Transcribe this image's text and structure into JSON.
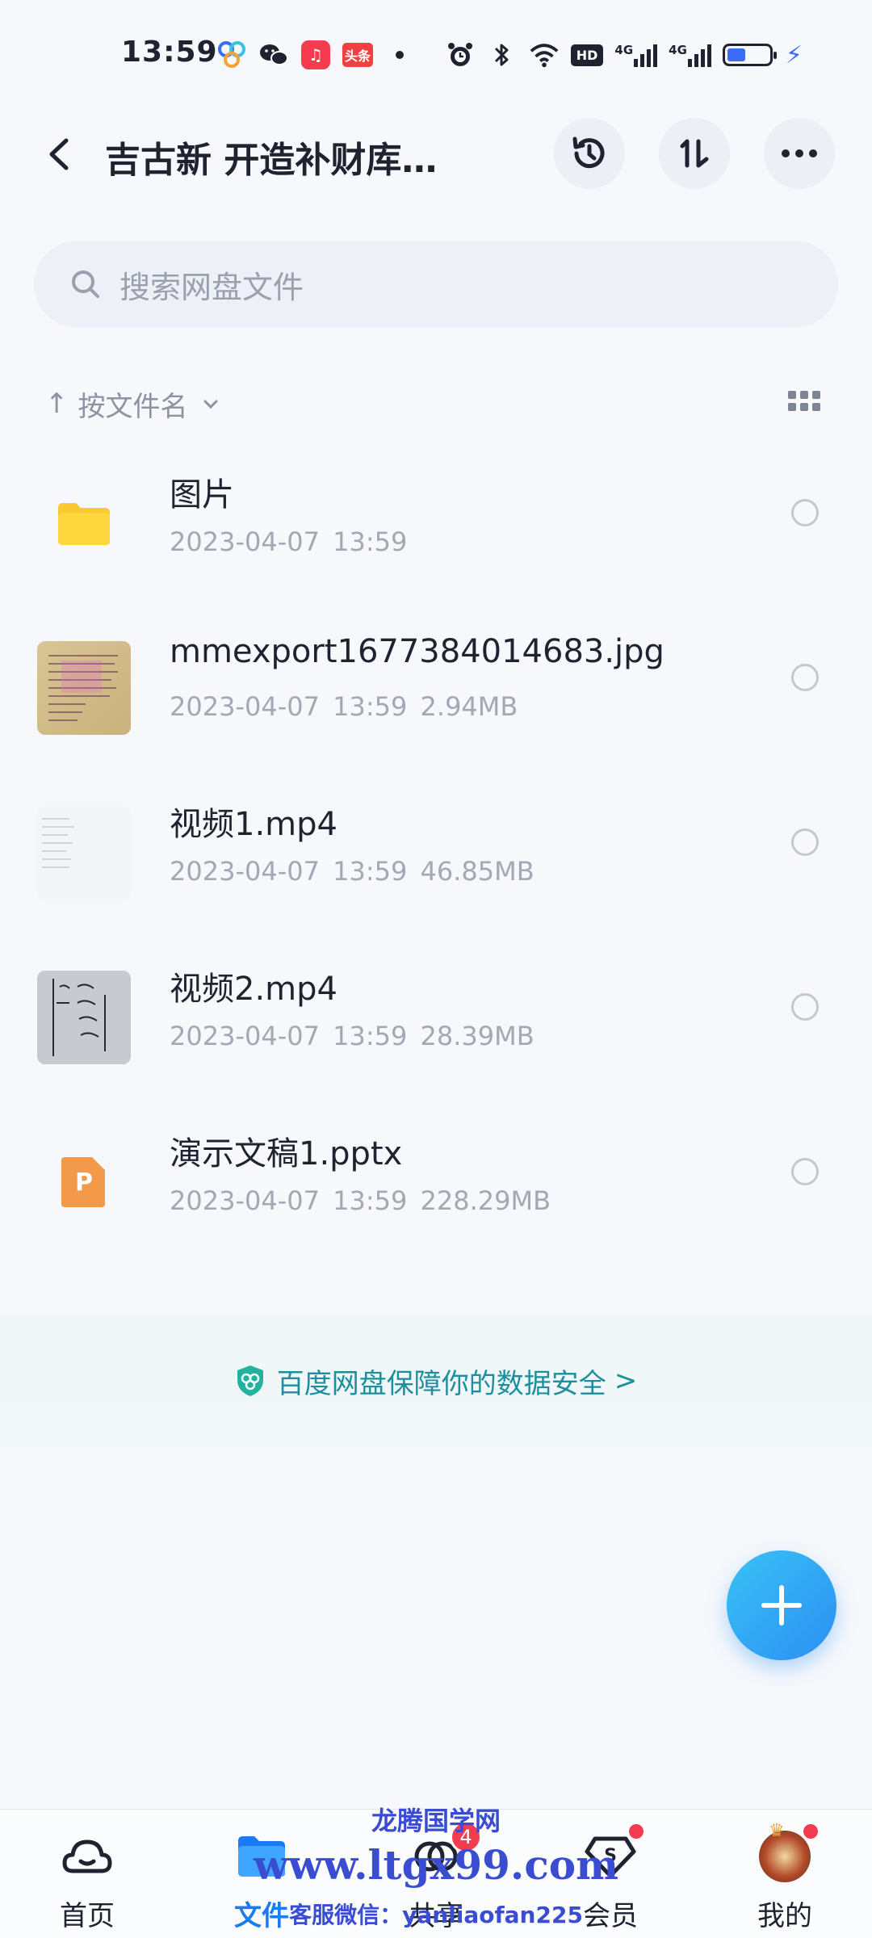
{
  "status_bar": {
    "time": "13:59",
    "toutiao_label": "头条",
    "hd_label": "HD",
    "net1": "4G",
    "net2": "4G",
    "battery_level": 0.45,
    "icons": [
      "baidu-cloud-icon",
      "wechat-icon",
      "netease-music-icon",
      "toutiao-icon",
      "dot-icon",
      "alarm-icon",
      "bluetooth-icon",
      "wifi-icon",
      "hd-icon",
      "signal-icon",
      "signal-icon",
      "battery-icon",
      "charging-icon"
    ]
  },
  "header": {
    "title": "吉古新 开造补财库…",
    "buttons": [
      "history-icon",
      "sort-icon",
      "more-icon"
    ]
  },
  "search": {
    "placeholder": "搜索网盘文件"
  },
  "sort": {
    "arrow": "↑",
    "label": "按文件名"
  },
  "files": [
    {
      "name": "图片",
      "meta": "2023-04-07  13:59",
      "kind": "folder"
    },
    {
      "name": "mmexport1677384014683.jpg",
      "meta": "2023-04-07  13:59  2.94MB",
      "kind": "image"
    },
    {
      "name": "视频1.mp4",
      "meta": "2023-04-07  13:59  46.85MB",
      "kind": "video"
    },
    {
      "name": "视频2.mp4",
      "meta": "2023-04-07  13:59  28.39MB",
      "kind": "video"
    },
    {
      "name": "演示文稿1.pptx",
      "meta": "2023-04-07  13:59  228.29MB",
      "kind": "pptx"
    }
  ],
  "pptx_letter": "P",
  "banner": {
    "text": "百度网盘保障你的数据安全",
    "chevron": ">"
  },
  "bottom_nav": [
    {
      "label": "首页",
      "active": false
    },
    {
      "label": "文件",
      "active": true
    },
    {
      "label": "共享",
      "active": false,
      "badge": "4"
    },
    {
      "label": "会员",
      "active": false
    },
    {
      "label": "我的",
      "active": false
    }
  ],
  "watermark": {
    "line1": "龙腾国学网",
    "line2": "www.ltgx99.com",
    "line3": "客服微信：yanliaofan225"
  },
  "colors": {
    "accent": "#1a7bf4",
    "folder": "#f8c931",
    "pptx": "#f39a4a",
    "badge": "#f43b4f",
    "banner_text": "#1c8f9e"
  }
}
